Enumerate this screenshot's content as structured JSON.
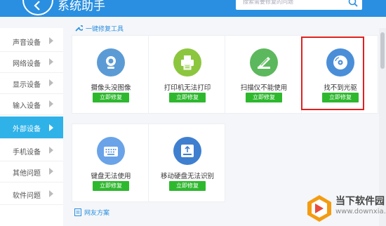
{
  "header": {
    "title": "系统助手",
    "search_placeholder": "搜索需要修复的问题"
  },
  "sidebar": {
    "items": [
      {
        "label": "声音设备"
      },
      {
        "label": "网络设备"
      },
      {
        "label": "显示设备"
      },
      {
        "label": "输入设备"
      },
      {
        "label": "外部设备",
        "active": true
      },
      {
        "label": "手机设备"
      },
      {
        "label": "其他问题"
      },
      {
        "label": "软件问题"
      }
    ]
  },
  "section": {
    "title": "一键修复工具"
  },
  "fix_label": "立即修复",
  "cards": [
    {
      "name": "摄像头没图像",
      "icon": "camera-icon",
      "color": "#5b9bd5"
    },
    {
      "name": "打印机无法打印",
      "icon": "printer-icon",
      "color": "#8cc63f"
    },
    {
      "name": "扫描仪不能使用",
      "icon": "scanner-icon",
      "color": "#5cb85c"
    },
    {
      "name": "找不到光驱",
      "icon": "disc-icon",
      "color": "#4a8ed8"
    },
    {
      "name": "键盘无法使用",
      "icon": "keyboard-icon",
      "color": "#6aa3e8"
    },
    {
      "name": "移动硬盘无法识别",
      "icon": "hard-drive-icon",
      "color": "#3f7fd0"
    }
  ],
  "bottom_link": "网友方案",
  "watermark": {
    "title": "当下软件园",
    "url": "www.downxia.com"
  },
  "colors": {
    "header": "#2a8fe0",
    "active_nav": "#2fb2e8",
    "fix_button": "#2eb82e",
    "highlight": "#e02020"
  }
}
